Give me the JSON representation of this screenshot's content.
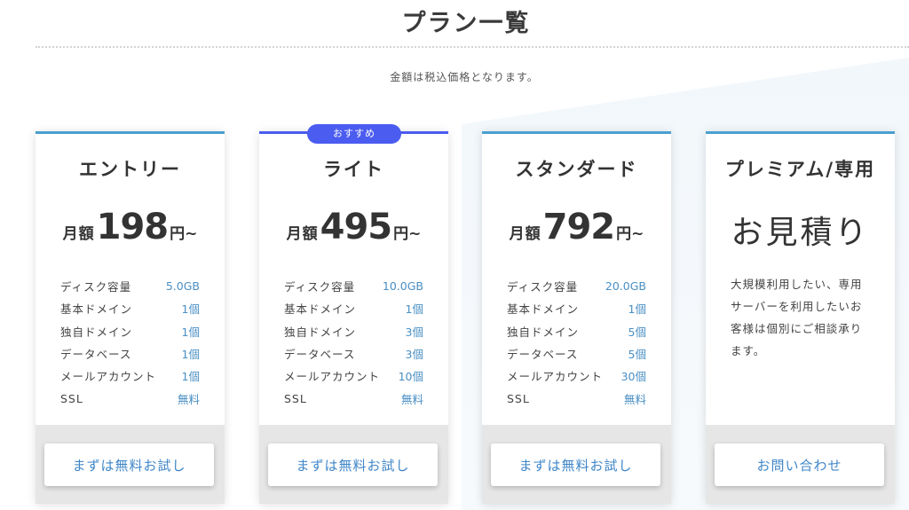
{
  "page": {
    "title": "プラン一覧",
    "note": "金額は税込価格となります。"
  },
  "colors": {
    "accent_blue": "#4a9fd0",
    "recommended": "#4b5cf0",
    "link": "#3f86c8",
    "footer_gray": "#e6e6e6"
  },
  "plans": [
    {
      "name": "エントリー",
      "price_prefix": "月額",
      "price": "198",
      "price_suffix": "円~",
      "specs": [
        {
          "label": "ディスク容量",
          "value": "5.0GB"
        },
        {
          "label": "基本ドメイン",
          "value": "1個"
        },
        {
          "label": "独自ドメイン",
          "value": "1個"
        },
        {
          "label": "データベース",
          "value": "1個"
        },
        {
          "label": "メールアカウント",
          "value": "1個"
        },
        {
          "label": "SSL",
          "value": "無料"
        }
      ],
      "button": "まずは無料お試し"
    },
    {
      "name": "ライト",
      "badge": "おすすめ",
      "price_prefix": "月額",
      "price": "495",
      "price_suffix": "円~",
      "specs": [
        {
          "label": "ディスク容量",
          "value": "10.0GB"
        },
        {
          "label": "基本ドメイン",
          "value": "1個"
        },
        {
          "label": "独自ドメイン",
          "value": "3個"
        },
        {
          "label": "データベース",
          "value": "3個"
        },
        {
          "label": "メールアカウント",
          "value": "10個"
        },
        {
          "label": "SSL",
          "value": "無料"
        }
      ],
      "button": "まずは無料お試し"
    },
    {
      "name": "スタンダード",
      "price_prefix": "月額",
      "price": "792",
      "price_suffix": "円~",
      "specs": [
        {
          "label": "ディスク容量",
          "value": "20.0GB"
        },
        {
          "label": "基本ドメイン",
          "value": "1個"
        },
        {
          "label": "独自ドメイン",
          "value": "5個"
        },
        {
          "label": "データベース",
          "value": "5個"
        },
        {
          "label": "メールアカウント",
          "value": "30個"
        },
        {
          "label": "SSL",
          "value": "無料"
        }
      ],
      "button": "まずは無料お試し"
    },
    {
      "name": "プレミアム/専用",
      "price_text": "お見積り",
      "description": "大規模利用したい、専用サーバーを利用したいお客様は個別にご相談承ります。",
      "button": "お問い合わせ"
    }
  ]
}
